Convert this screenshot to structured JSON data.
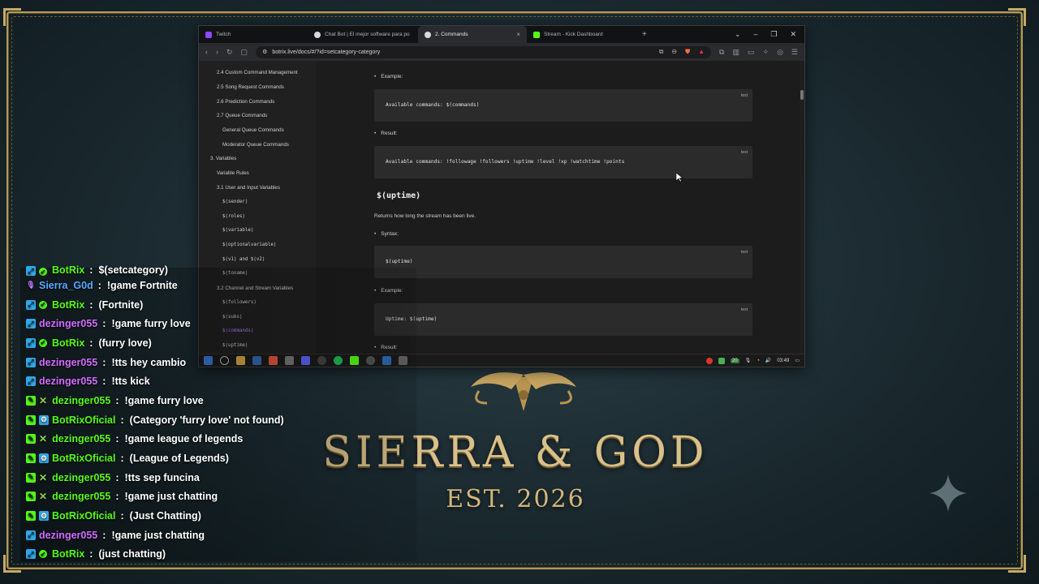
{
  "browser": {
    "tabs": [
      {
        "label": "Twitch",
        "color": "#9146ff",
        "active": false
      },
      {
        "label": "Chat Bot | El mejor software para po",
        "color": "#e6e6e6",
        "active": false
      },
      {
        "label": "2. Commands",
        "color": "#e6e6e6",
        "active": true
      },
      {
        "label": "Stream - Kick Dashboard",
        "color": "#53fc18",
        "active": false
      }
    ],
    "url": "botrix.live/docs/#/?id=setcategory-category",
    "new_tab_glyph": "+",
    "close_tab_glyph": "×"
  },
  "sidebar": {
    "items": [
      {
        "label": "2.4 Custom Command Management",
        "level": 2
      },
      {
        "label": "2.5 Song Request Commands",
        "level": 2
      },
      {
        "label": "2.6 Prediction Commands",
        "level": 2
      },
      {
        "label": "2.7 Queue Commands",
        "level": 2
      },
      {
        "label": "General Queue Commands",
        "level": 3
      },
      {
        "label": "Moderator Queue Commands",
        "level": 3
      },
      {
        "label": "3. Variables",
        "level": 1
      },
      {
        "label": "Variable Rules",
        "level": 2
      },
      {
        "label": "3.1 User and Input Variables",
        "level": 2
      },
      {
        "label": "$(sender)",
        "level": 3,
        "code": true
      },
      {
        "label": "$(roles)",
        "level": 3,
        "code": true
      },
      {
        "label": "$(variable)",
        "level": 3,
        "code": true
      },
      {
        "label": "$(optionalvariable)",
        "level": 3,
        "code": true
      },
      {
        "label": "$(v1) and $(v2)",
        "level": 3,
        "code": true
      },
      {
        "label": "$(toname)",
        "level": 3,
        "code": true
      },
      {
        "label": "3.2 Channel and Stream Variables",
        "level": 2
      },
      {
        "label": "$(followers)",
        "level": 3,
        "code": true
      },
      {
        "label": "$(subs)",
        "level": 3,
        "code": true
      },
      {
        "label": "$(commands)",
        "level": 3,
        "code": true,
        "active": true
      },
      {
        "label": "$(uptime)",
        "level": 3,
        "code": true
      }
    ]
  },
  "doc": {
    "example_label": "Example:",
    "result_label": "Result:",
    "syntax_label": "Syntax:",
    "code_lang": "text",
    "example1_code": "Available commands: $(commands)",
    "result1_code": "Available commands: !followage !followers !uptime !level !xp !watchtime !points",
    "heading": "$(uptime)",
    "description": "Returns how long the stream has been live.",
    "syntax_code": "$(uptime)",
    "example2_code": "Uptime: $(uptime)"
  },
  "taskbar": {
    "time": "03:49",
    "badge_count": "20"
  },
  "chat": {
    "lines": [
      {
        "badge": "kick",
        "mod": true,
        "name": "BotRix",
        "name_color": "#53fc18",
        "message": "$(setcategory)",
        "clipped": true
      },
      {
        "badge": "purple",
        "mod": false,
        "name": "Sierra_G0d",
        "name_color": "#5aa7ff",
        "message": "!game Fortnite"
      },
      {
        "badge": "kick",
        "mod": true,
        "name": "BotRix",
        "name_color": "#53fc18",
        "message": "(Fortnite)"
      },
      {
        "badge": "kick",
        "mod": false,
        "name": "dezinger055",
        "name_color": "#d36bff",
        "message": "!game furry love"
      },
      {
        "badge": "kick",
        "mod": true,
        "name": "BotRix",
        "name_color": "#53fc18",
        "message": "(furry love)"
      },
      {
        "badge": "kick",
        "mod": false,
        "name": "dezinger055",
        "name_color": "#d36bff",
        "message": "!tts hey cambio"
      },
      {
        "badge": "kick",
        "mod": false,
        "name": "dezinger055",
        "name_color": "#d36bff",
        "message": "!tts kick"
      },
      {
        "badge": "kickgreen",
        "mod": "x",
        "name": "dezinger055",
        "name_color": "#53fc18",
        "message": "!game furry love"
      },
      {
        "badge": "kickgreen",
        "mod": "bot",
        "name": "BotRixOficial",
        "name_color": "#53fc18",
        "message": "(Category 'furry love' not found)"
      },
      {
        "badge": "kickgreen",
        "mod": "x",
        "name": "dezinger055",
        "name_color": "#53fc18",
        "message": "!game league of legends"
      },
      {
        "badge": "kickgreen",
        "mod": "bot",
        "name": "BotRixOficial",
        "name_color": "#53fc18",
        "message": "(League of Legends)"
      },
      {
        "badge": "kickgreen",
        "mod": "x",
        "name": "dezinger055",
        "name_color": "#53fc18",
        "message": "!tts sep funcina"
      },
      {
        "badge": "kickgreen",
        "mod": "x",
        "name": "dezinger055",
        "name_color": "#53fc18",
        "message": "!game just chatting"
      },
      {
        "badge": "kickgreen",
        "mod": "bot",
        "name": "BotRixOficial",
        "name_color": "#53fc18",
        "message": "(Just Chatting)"
      },
      {
        "badge": "kick",
        "mod": false,
        "name": "dezinger055",
        "name_color": "#d36bff",
        "message": "!game just chatting"
      },
      {
        "badge": "kick",
        "mod": true,
        "name": "BotRix",
        "name_color": "#53fc18",
        "message": "(just chatting)"
      }
    ]
  },
  "logo": {
    "title": "SIERRA & GOD",
    "est": "EST. 2026"
  },
  "colors": {
    "gold": "#d9c08a",
    "kick_green": "#53fc18",
    "kick_blue": "#2fa8e8"
  }
}
